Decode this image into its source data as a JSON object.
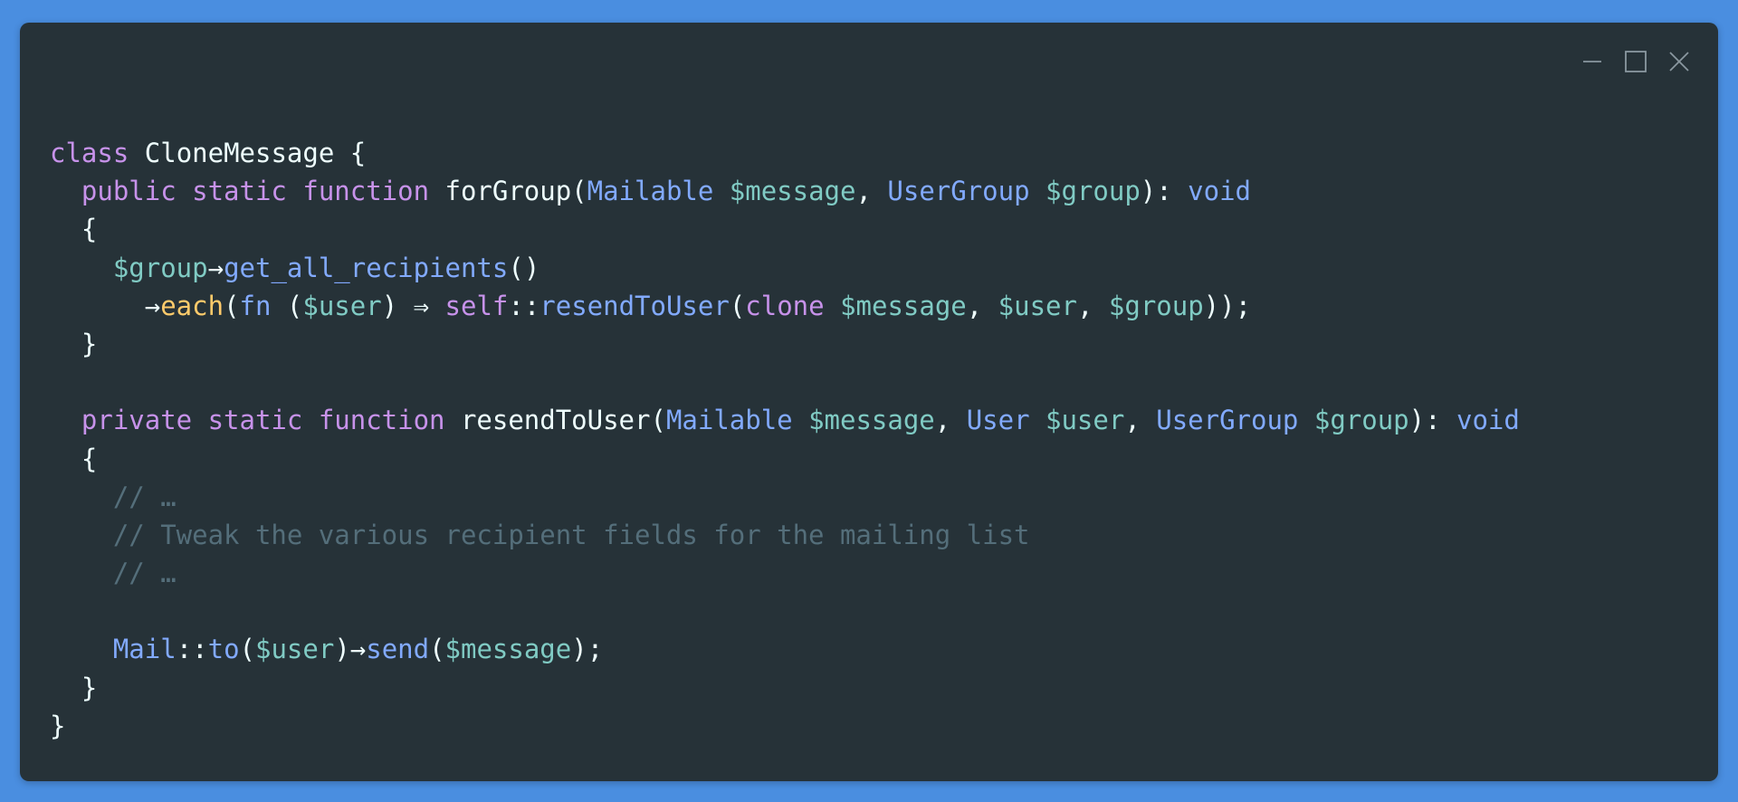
{
  "window": {
    "controls": {
      "minimize_icon": "minimize-icon",
      "maximize_icon": "maximize-icon",
      "close_icon": "close-icon"
    }
  },
  "colors": {
    "background": "#4a8ee0",
    "editor": "#263238",
    "keyword": "#c792ea",
    "function": "#82aaff",
    "variable": "#80cbc4",
    "highlight": "#ffcb6b",
    "plain": "#eeffff",
    "comment": "#546e7a"
  },
  "code": {
    "lines": [
      [
        {
          "t": "class",
          "c": "k"
        },
        {
          "t": " CloneMessage {",
          "c": "p"
        }
      ],
      [
        {
          "t": "  ",
          "c": "p"
        },
        {
          "t": "public static function",
          "c": "k"
        },
        {
          "t": " forGroup(",
          "c": "p"
        },
        {
          "t": "Mailable",
          "c": "fn"
        },
        {
          "t": " ",
          "c": "p"
        },
        {
          "t": "$message",
          "c": "v"
        },
        {
          "t": ", ",
          "c": "p"
        },
        {
          "t": "UserGroup",
          "c": "fn"
        },
        {
          "t": " ",
          "c": "p"
        },
        {
          "t": "$group",
          "c": "v"
        },
        {
          "t": "): ",
          "c": "p"
        },
        {
          "t": "void",
          "c": "fn"
        }
      ],
      [
        {
          "t": "  {",
          "c": "p"
        }
      ],
      [
        {
          "t": "    ",
          "c": "p"
        },
        {
          "t": "$group",
          "c": "v"
        },
        {
          "t": "→",
          "c": "p"
        },
        {
          "t": "get_all_recipients",
          "c": "fn"
        },
        {
          "t": "()",
          "c": "p"
        }
      ],
      [
        {
          "t": "      →",
          "c": "p"
        },
        {
          "t": "each",
          "c": "y"
        },
        {
          "t": "(",
          "c": "p"
        },
        {
          "t": "fn",
          "c": "fn"
        },
        {
          "t": " (",
          "c": "p"
        },
        {
          "t": "$user",
          "c": "v"
        },
        {
          "t": ") ⇒ ",
          "c": "p"
        },
        {
          "t": "self",
          "c": "k"
        },
        {
          "t": "::",
          "c": "p"
        },
        {
          "t": "resendToUser",
          "c": "fn"
        },
        {
          "t": "(",
          "c": "p"
        },
        {
          "t": "clone",
          "c": "k"
        },
        {
          "t": " ",
          "c": "p"
        },
        {
          "t": "$message",
          "c": "v"
        },
        {
          "t": ", ",
          "c": "p"
        },
        {
          "t": "$user",
          "c": "v"
        },
        {
          "t": ", ",
          "c": "p"
        },
        {
          "t": "$group",
          "c": "v"
        },
        {
          "t": "));",
          "c": "p"
        }
      ],
      [
        {
          "t": "  }",
          "c": "p"
        }
      ],
      [],
      [
        {
          "t": "  ",
          "c": "p"
        },
        {
          "t": "private static function",
          "c": "k"
        },
        {
          "t": " resendToUser(",
          "c": "p"
        },
        {
          "t": "Mailable",
          "c": "fn"
        },
        {
          "t": " ",
          "c": "p"
        },
        {
          "t": "$message",
          "c": "v"
        },
        {
          "t": ", ",
          "c": "p"
        },
        {
          "t": "User",
          "c": "fn"
        },
        {
          "t": " ",
          "c": "p"
        },
        {
          "t": "$user",
          "c": "v"
        },
        {
          "t": ", ",
          "c": "p"
        },
        {
          "t": "UserGroup",
          "c": "fn"
        },
        {
          "t": " ",
          "c": "p"
        },
        {
          "t": "$group",
          "c": "v"
        },
        {
          "t": "): ",
          "c": "p"
        },
        {
          "t": "void",
          "c": "fn"
        }
      ],
      [
        {
          "t": "  {",
          "c": "p"
        }
      ],
      [
        {
          "t": "    // …",
          "c": "c"
        }
      ],
      [
        {
          "t": "    // Tweak the various recipient fields for the mailing list",
          "c": "c"
        }
      ],
      [
        {
          "t": "    // …",
          "c": "c"
        }
      ],
      [],
      [
        {
          "t": "    ",
          "c": "p"
        },
        {
          "t": "Mail",
          "c": "fn"
        },
        {
          "t": "::",
          "c": "p"
        },
        {
          "t": "to",
          "c": "fn"
        },
        {
          "t": "(",
          "c": "p"
        },
        {
          "t": "$user",
          "c": "v"
        },
        {
          "t": ")→",
          "c": "p"
        },
        {
          "t": "send",
          "c": "fn"
        },
        {
          "t": "(",
          "c": "p"
        },
        {
          "t": "$message",
          "c": "v"
        },
        {
          "t": ");",
          "c": "p"
        }
      ],
      [
        {
          "t": "  }",
          "c": "p"
        }
      ],
      [
        {
          "t": "}",
          "c": "p"
        }
      ]
    ]
  }
}
